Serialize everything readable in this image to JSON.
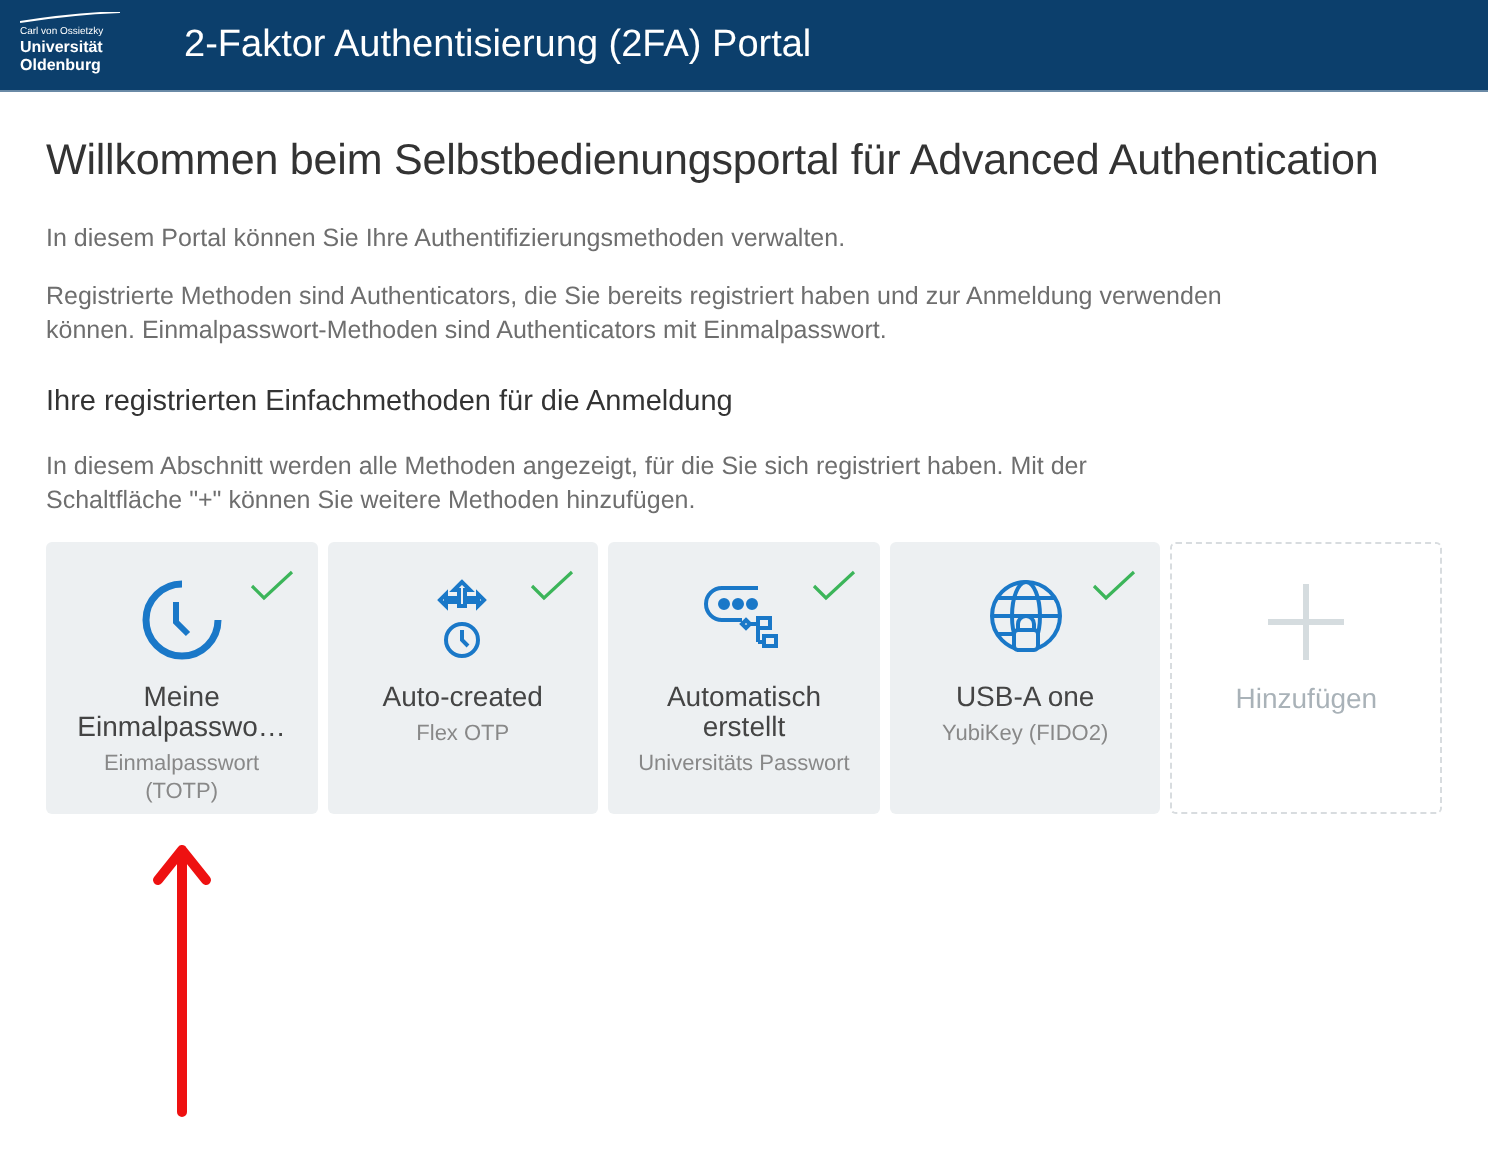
{
  "header": {
    "logo": {
      "line_1": "Carl von Ossietzky",
      "line_2": "Universität",
      "line_3": "Oldenburg"
    },
    "title": "2-Faktor Authentisierung (2FA) Portal"
  },
  "page_title": "Willkommen beim Selbstbedienungsportal für Advanced Authentication",
  "intro": [
    "In diesem Portal können Sie Ihre Authentifizierungsmethoden verwalten.",
    "Registrierte Methoden sind Authenticators, die Sie bereits registriert haben und zur Anmeldung verwenden können. Einmalpasswort-Methoden sind Authenticators mit Einmalpasswort."
  ],
  "section": {
    "title": "Ihre registrierten Einfachmethoden für die Anmeldung",
    "description": "In diesem Abschnitt werden alle Methoden angezeigt, für die Sie sich registriert haben. Mit der Schaltfläche \"+\" können Sie weitere Methoden hinzufügen.",
    "cards": [
      {
        "kind": "totp",
        "name": "Meine Einmalpasswo…",
        "type": "Einmalpasswort (TOTP)",
        "registered": true
      },
      {
        "kind": "flex",
        "name": "Auto-created",
        "type": "Flex OTP",
        "registered": true
      },
      {
        "kind": "password",
        "name": "Automatisch erstellt",
        "type": "Universitäts Passwort",
        "registered": true
      },
      {
        "kind": "fido",
        "name": "USB-A one",
        "type": "YubiKey (FIDO2)",
        "registered": true
      },
      {
        "kind": "add",
        "name": "Hinzufügen"
      }
    ]
  }
}
